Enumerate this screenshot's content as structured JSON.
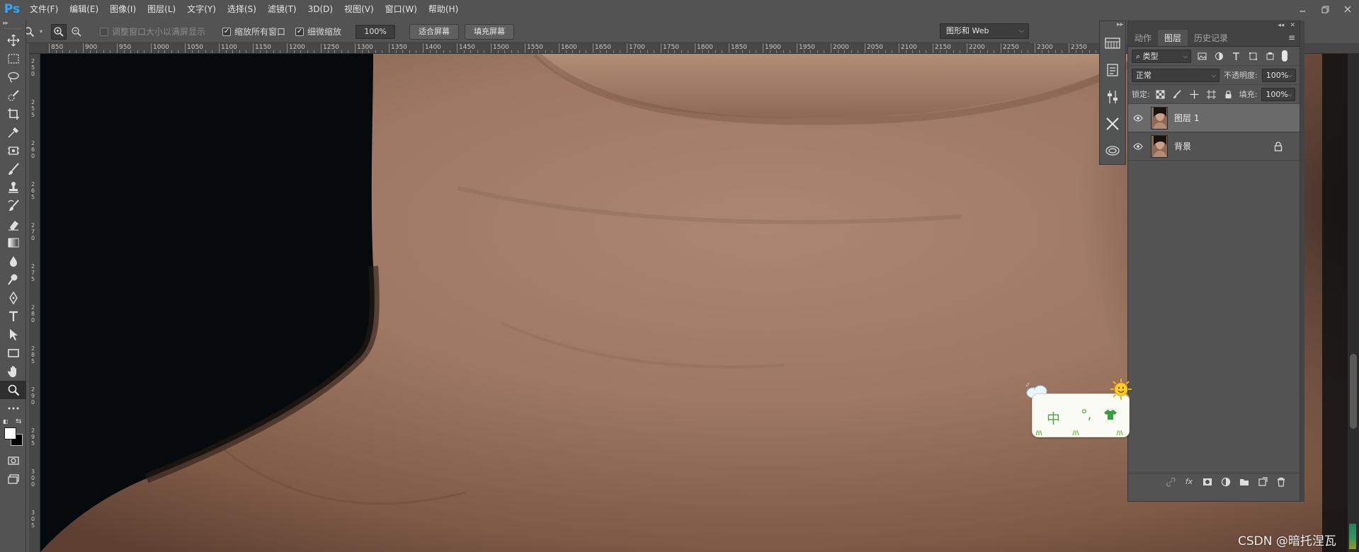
{
  "app": {
    "logo": "Ps",
    "menu": [
      "文件(F)",
      "编辑(E)",
      "图像(I)",
      "图层(L)",
      "文字(Y)",
      "选择(S)",
      "滤镜(T)",
      "3D(D)",
      "视图(V)",
      "窗口(W)",
      "帮助(H)"
    ],
    "window_controls": [
      "minimize-icon",
      "restore-icon",
      "close-icon"
    ]
  },
  "options": {
    "tool_icon": "zoom-icon",
    "resize_windows_label": "调整窗口大小以满屏显示",
    "resize_windows_checked": false,
    "zoom_all_label": "缩放所有窗口",
    "zoom_all_checked": true,
    "scrubby_label": "细微缩放",
    "scrubby_checked": true,
    "zoom_value": "100%",
    "fit_screen_label": "适合屏幕",
    "fill_screen_label": "填充屏幕",
    "workspace_label": "图形和 Web"
  },
  "rulers": {
    "h_labels": [
      "850",
      "900",
      "950",
      "1000",
      "1050",
      "1100",
      "1150",
      "1200",
      "1250",
      "1300",
      "1350",
      "1400",
      "1450",
      "1500",
      "1550",
      "1600",
      "1650",
      "1700",
      "1750",
      "1800",
      "1850",
      "1900",
      "1950",
      "2000",
      "2050",
      "2100",
      "2150",
      "2200",
      "2250",
      "2300",
      "2350"
    ],
    "v_labels": [
      "250",
      "255",
      "260",
      "265",
      "270",
      "275",
      "280",
      "285",
      "290",
      "295",
      "300",
      "305"
    ]
  },
  "tools": [
    "move-icon",
    "marquee-icon",
    "lasso-icon",
    "quick-select-icon",
    "crop-icon",
    "eyedropper-icon",
    "frame-icon",
    "brush-icon",
    "stamp-icon",
    "history-brush-icon",
    "eraser-icon",
    "gradient-icon",
    "blur-icon",
    "dodge-icon",
    "pen-icon",
    "type-icon",
    "path-select-icon",
    "rectangle-icon",
    "hand-icon",
    "zoom-icon",
    "more-icon"
  ],
  "colors": {
    "foreground": "#ffffff",
    "background": "#000000",
    "accent": "#31a8ff",
    "panel": "#535353",
    "selected_layer": "#6a6a6a",
    "ime_green": "#48a84b"
  },
  "layers_panel": {
    "tabs": [
      "动作",
      "图层",
      "历史记录"
    ],
    "active_tab": "图层",
    "filter_label": "类型",
    "blend_mode": "正常",
    "opacity_label": "不透明度:",
    "opacity_value": "100%",
    "lock_label": "锁定:",
    "fill_label": "填充:",
    "fill_value": "100%",
    "layers": [
      {
        "name": "图层 1",
        "visible": true,
        "selected": true,
        "locked": false
      },
      {
        "name": "背景",
        "visible": true,
        "selected": false,
        "locked": true
      }
    ],
    "bottom_icons": [
      "link-icon",
      "fx-icon",
      "mask-icon",
      "adjustment-icon",
      "group-icon",
      "new-layer-icon",
      "trash-icon"
    ],
    "fx_label": "fx"
  },
  "ime": {
    "mode": "中",
    "punct": "°,"
  },
  "watermark": "CSDN @暗托涅瓦"
}
